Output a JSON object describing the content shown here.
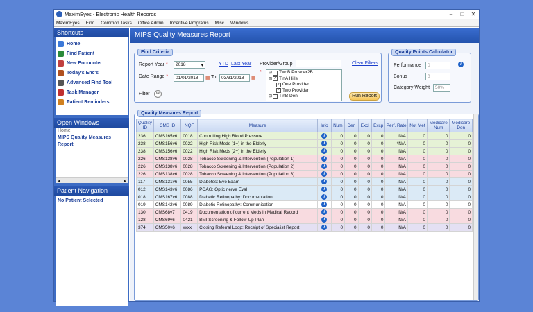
{
  "window": {
    "title": "MaximEyes - Electronic Health Records"
  },
  "menu": [
    "MaximEyes",
    "Find",
    "Common Tasks",
    "Office Admin",
    "Incentive Programs",
    "Misc",
    "Windows"
  ],
  "shortcuts": {
    "title": "Shortcuts",
    "items": [
      {
        "label": "Home",
        "color": "#3c78d8"
      },
      {
        "label": "Find Patient",
        "color": "#2a8a3a"
      },
      {
        "label": "New Encounter",
        "color": "#c04040"
      },
      {
        "label": "Today's Enc's",
        "color": "#b05020"
      },
      {
        "label": "Advanced Find Tool",
        "color": "#555555"
      },
      {
        "label": "Task Manager",
        "color": "#c03030"
      },
      {
        "label": "Patient Reminders",
        "color": "#d08020"
      }
    ]
  },
  "open_windows": {
    "title": "Open Windows",
    "items": [
      "Home",
      "MIPS Quality Measures Report"
    ]
  },
  "patient_nav": {
    "title": "Patient Navigation",
    "status": "No Patient Selected"
  },
  "main": {
    "title": "MIPS Quality Measures Report"
  },
  "find": {
    "title": "Find Criteria",
    "report_year_label": "Report Year",
    "report_year": "2018",
    "ytd": "YTD",
    "last_year": "Last Year",
    "date_range_label": "Date Range",
    "date_from": "01/01/2018",
    "to_label": "To",
    "date_to": "03/31/2018",
    "provider_label": "Provider/Group",
    "clear_filters": "Clear Filters",
    "filter_label": "Filter",
    "run_report": "Run Report",
    "tree": [
      {
        "label": "TwoB Provder2B",
        "checked": false,
        "indent": 0
      },
      {
        "label": "TinA Hills",
        "checked": true,
        "indent": 0
      },
      {
        "label": "One Provider",
        "checked": true,
        "indent": 1
      },
      {
        "label": "Two Provider",
        "checked": true,
        "indent": 1
      },
      {
        "label": "TinB Den",
        "checked": false,
        "indent": 0
      }
    ]
  },
  "calc": {
    "title": "Quality Points Calculator",
    "performance_label": "Performance",
    "performance": "0",
    "bonus_label": "Bonus",
    "bonus": "0",
    "category_weight_label": "Category Weight",
    "category_weight": "50%"
  },
  "report": {
    "title": "Quality Measures Report",
    "columns": [
      "Quality ID",
      "CMS ID",
      "NQF",
      "Measure",
      "Info",
      "Num",
      "Den",
      "Excl",
      "Excp",
      "Perf. Rate",
      "Not Met",
      "Medicare Num",
      "Medicare Den"
    ],
    "rows": [
      {
        "style": "green",
        "cells": [
          "236",
          "CMS165v6",
          "0018",
          "Controlling High Blood Pressure",
          "",
          "0",
          "0",
          "0",
          "0",
          "N/A",
          "0",
          "0",
          "0"
        ]
      },
      {
        "style": "green",
        "cells": [
          "238",
          "CMS156v6",
          "0022",
          "High Risk Meds (1+) in the Elderly",
          "",
          "0",
          "0",
          "0",
          "0",
          "*N/A",
          "0",
          "0",
          "0"
        ]
      },
      {
        "style": "green",
        "cells": [
          "238",
          "CMS156v6",
          "0022",
          "High Risk Meds (2+) in the Elderly",
          "",
          "0",
          "0",
          "0",
          "0",
          "N/A",
          "0",
          "0",
          "0"
        ]
      },
      {
        "style": "pink",
        "cells": [
          "226",
          "CMS138v6",
          "0028",
          "Tobacco Screening & Intervention (Population 1)",
          "",
          "0",
          "0",
          "0",
          "0",
          "N/A",
          "0",
          "0",
          "0"
        ]
      },
      {
        "style": "pink",
        "cells": [
          "226",
          "CMS138v6",
          "0028",
          "Tobacco Screening & Intervention (Population 2)",
          "",
          "0",
          "0",
          "0",
          "0",
          "N/A",
          "0",
          "0",
          "0"
        ]
      },
      {
        "style": "pink",
        "cells": [
          "226",
          "CMS138v6",
          "0028",
          "Tobacco Screening & Intervention (Population 3)",
          "",
          "0",
          "0",
          "0",
          "0",
          "N/A",
          "0",
          "0",
          "0"
        ]
      },
      {
        "style": "blue",
        "cells": [
          "117",
          "CMS131v6",
          "0055",
          "Diabetes: Eye Exam",
          "",
          "0",
          "0",
          "0",
          "0",
          "N/A",
          "0",
          "0",
          "0"
        ]
      },
      {
        "style": "blue",
        "cells": [
          "012",
          "CMS143v6",
          "0086",
          "POAG: Optic nerve Eval",
          "",
          "0",
          "0",
          "0",
          "0",
          "N/A",
          "0",
          "0",
          "0"
        ]
      },
      {
        "style": "blue",
        "cells": [
          "018",
          "CMS167v6",
          "0088",
          "Diabetic Retinopathy: Documentation",
          "",
          "0",
          "0",
          "0",
          "0",
          "N/A",
          "0",
          "0",
          "0"
        ]
      },
      {
        "style": "white",
        "cells": [
          "019",
          "CMS142v6",
          "0089",
          "Diabetic Retinopathy: Communication",
          "",
          "0",
          "0",
          "0",
          "0",
          "N/A",
          "0",
          "0",
          "0"
        ]
      },
      {
        "style": "pink",
        "cells": [
          "130",
          "CMS68v7",
          "0419",
          "Documentation of current Meds in Medical Record",
          "",
          "0",
          "0",
          "0",
          "0",
          "N/A",
          "0",
          "0",
          "0"
        ]
      },
      {
        "style": "pink",
        "cells": [
          "128",
          "CMS69v6",
          "0421",
          "BMI Screening & Follow-Up Plan",
          "",
          "0",
          "0",
          "0",
          "0",
          "N/A",
          "0",
          "0",
          "0"
        ]
      },
      {
        "style": "purple",
        "cells": [
          "374",
          "CMS50v6",
          "xxxx",
          "Closing Referral Loop: Receipt of Specialist Report",
          "",
          "0",
          "0",
          "0",
          "0",
          "N/A",
          "0",
          "0",
          "0"
        ]
      }
    ]
  }
}
